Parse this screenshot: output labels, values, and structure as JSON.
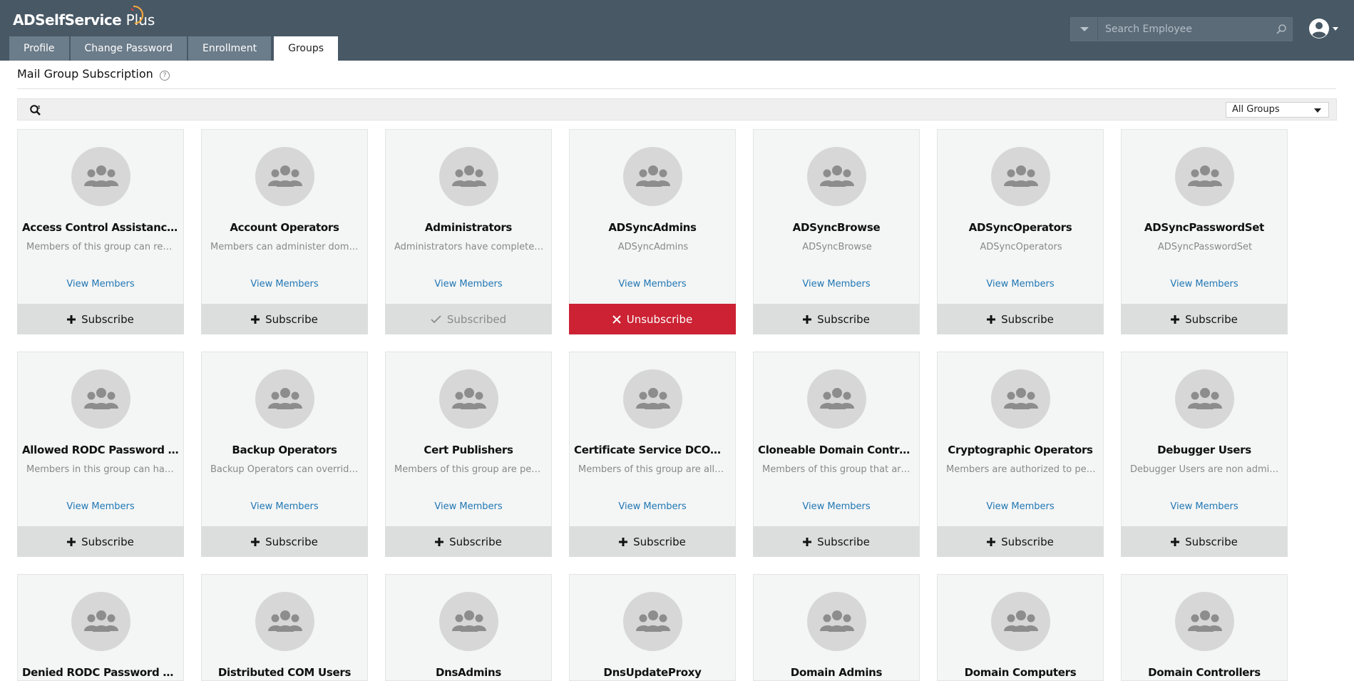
{
  "app": {
    "logo_main": "ADSelfService",
    "logo_suffix": " Plus"
  },
  "tabs": [
    {
      "label": "Profile",
      "active": false
    },
    {
      "label": "Change Password",
      "active": false
    },
    {
      "label": "Enrollment",
      "active": false
    },
    {
      "label": "Groups",
      "active": true
    }
  ],
  "search": {
    "placeholder": "Search Employee"
  },
  "page": {
    "title": "Mail Group Subscription",
    "help_glyph": "?"
  },
  "filter": {
    "selected": "All Groups"
  },
  "common": {
    "view_members": "View Members"
  },
  "colors": {
    "header_bg": "#485865",
    "tab_bg": "#6b7c8a",
    "link": "#1f77b4",
    "unsubscribe": "#cc2233"
  },
  "groups": [
    {
      "name": "Access Control Assistance Operators",
      "desc": "Members of this group can remotely query authorization",
      "action": "Subscribe",
      "state": "subscribe"
    },
    {
      "name": "Account Operators",
      "desc": "Members can administer domain user and group accounts",
      "action": "Subscribe",
      "state": "subscribe"
    },
    {
      "name": "Administrators",
      "desc": "Administrators have complete and unrestricted access",
      "action": "Subscribed",
      "state": "subscribed"
    },
    {
      "name": "ADSyncAdmins",
      "desc": "ADSyncAdmins",
      "action": "Unsubscribe",
      "state": "unsubscribe"
    },
    {
      "name": "ADSyncBrowse",
      "desc": "ADSyncBrowse",
      "action": "Subscribe",
      "state": "subscribe"
    },
    {
      "name": "ADSyncOperators",
      "desc": "ADSyncOperators",
      "action": "Subscribe",
      "state": "subscribe"
    },
    {
      "name": "ADSyncPasswordSet",
      "desc": "ADSyncPasswordSet",
      "action": "Subscribe",
      "state": "subscribe"
    },
    {
      "name": "Allowed RODC Password Replication Group",
      "desc": "Members in this group can have their passwords replicated",
      "action": "Subscribe",
      "state": "subscribe"
    },
    {
      "name": "Backup Operators",
      "desc": "Backup Operators can override security restrictions",
      "action": "Subscribe",
      "state": "subscribe"
    },
    {
      "name": "Cert Publishers",
      "desc": "Members of this group are permitted to publish certificates",
      "action": "Subscribe",
      "state": "subscribe"
    },
    {
      "name": "Certificate Service DCOM Access",
      "desc": "Members of this group are allowed to connect",
      "action": "Subscribe",
      "state": "subscribe"
    },
    {
      "name": "Cloneable Domain Controllers",
      "desc": "Members of this group that are domain controllers",
      "action": "Subscribe",
      "state": "subscribe"
    },
    {
      "name": "Cryptographic Operators",
      "desc": "Members are authorized to perform cryptographic operations",
      "action": "Subscribe",
      "state": "subscribe"
    },
    {
      "name": "Debugger Users",
      "desc": "Debugger Users are non administrators",
      "action": "Subscribe",
      "state": "subscribe"
    },
    {
      "name": "Denied RODC Password Replication Group",
      "desc": "",
      "action": "",
      "state": "partial"
    },
    {
      "name": "Distributed COM Users",
      "desc": "",
      "action": "",
      "state": "partial"
    },
    {
      "name": "DnsAdmins",
      "desc": "",
      "action": "",
      "state": "partial"
    },
    {
      "name": "DnsUpdateProxy",
      "desc": "",
      "action": "",
      "state": "partial"
    },
    {
      "name": "Domain Admins",
      "desc": "",
      "action": "",
      "state": "partial"
    },
    {
      "name": "Domain Computers",
      "desc": "",
      "action": "",
      "state": "partial"
    },
    {
      "name": "Domain Controllers",
      "desc": "",
      "action": "",
      "state": "partial"
    }
  ]
}
